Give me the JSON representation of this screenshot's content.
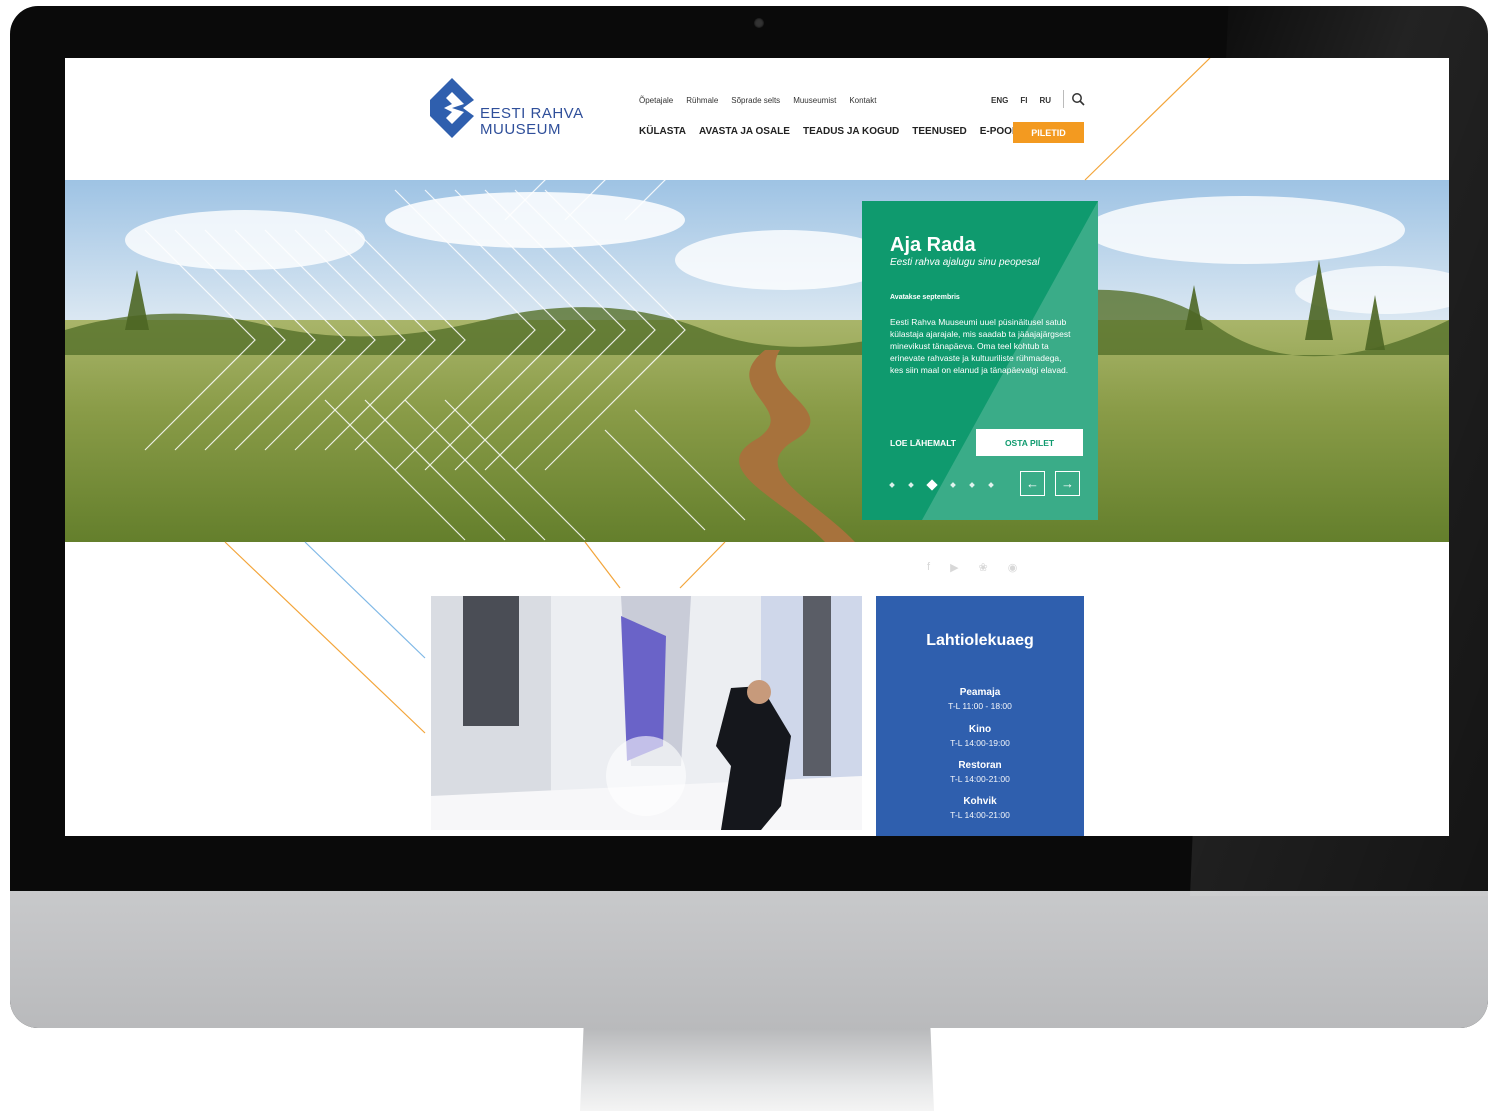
{
  "logo": {
    "line1": "EESTI RAHVA",
    "line2": "MUUSEUM"
  },
  "top_links": [
    "Õpetajale",
    "Rühmale",
    "Sõprade selts",
    "Muuseumist",
    "Kontakt"
  ],
  "languages": [
    "ENG",
    "FI",
    "RU"
  ],
  "main_nav": [
    "KÜLASTA",
    "AVASTA JA OSALE",
    "TEADUS JA KOGUD",
    "TEENUSED",
    "E-POOD"
  ],
  "tickets_label": "PILETID",
  "hero_card": {
    "title": "Aja Rada",
    "subtitle": "Eesti rahva ajalugu sinu peopesal",
    "date": "Avatakse septembris",
    "text": "Eesti Rahva Muuseumi uuel püsinäitusel satub külastaja ajarajale, mis saadab ta jääajajärgsest minevikust tänapäeva. Oma teel kohtub ta erinevate rahvaste ja kultuuriliste rühmadega, kes siin maal on elanud ja tänapäevalgi elavad.",
    "more_label": "LOE LÄHEMALT",
    "buy_label": "OSTA PILET",
    "slides_total": 6,
    "slide_active": 3
  },
  "social_icons": [
    "facebook-icon",
    "youtube-icon",
    "twitter-icon",
    "instagram-icon"
  ],
  "hours": {
    "title": "Lahtiolekuaeg",
    "items": [
      {
        "name": "Peamaja",
        "time": "T-L 11:00 - 18:00"
      },
      {
        "name": "Kino",
        "time": "T-L 14:00-19:00"
      },
      {
        "name": "Restoran",
        "time": "T-L 14:00-21:00"
      },
      {
        "name": "Kohvik",
        "time": "T-L 14:00-21:00"
      }
    ]
  },
  "colors": {
    "accent_orange": "#f39a20",
    "hero_green": "#0f9a6e",
    "hours_blue": "#2f5fae",
    "logo_blue": "#2f4f9a"
  }
}
